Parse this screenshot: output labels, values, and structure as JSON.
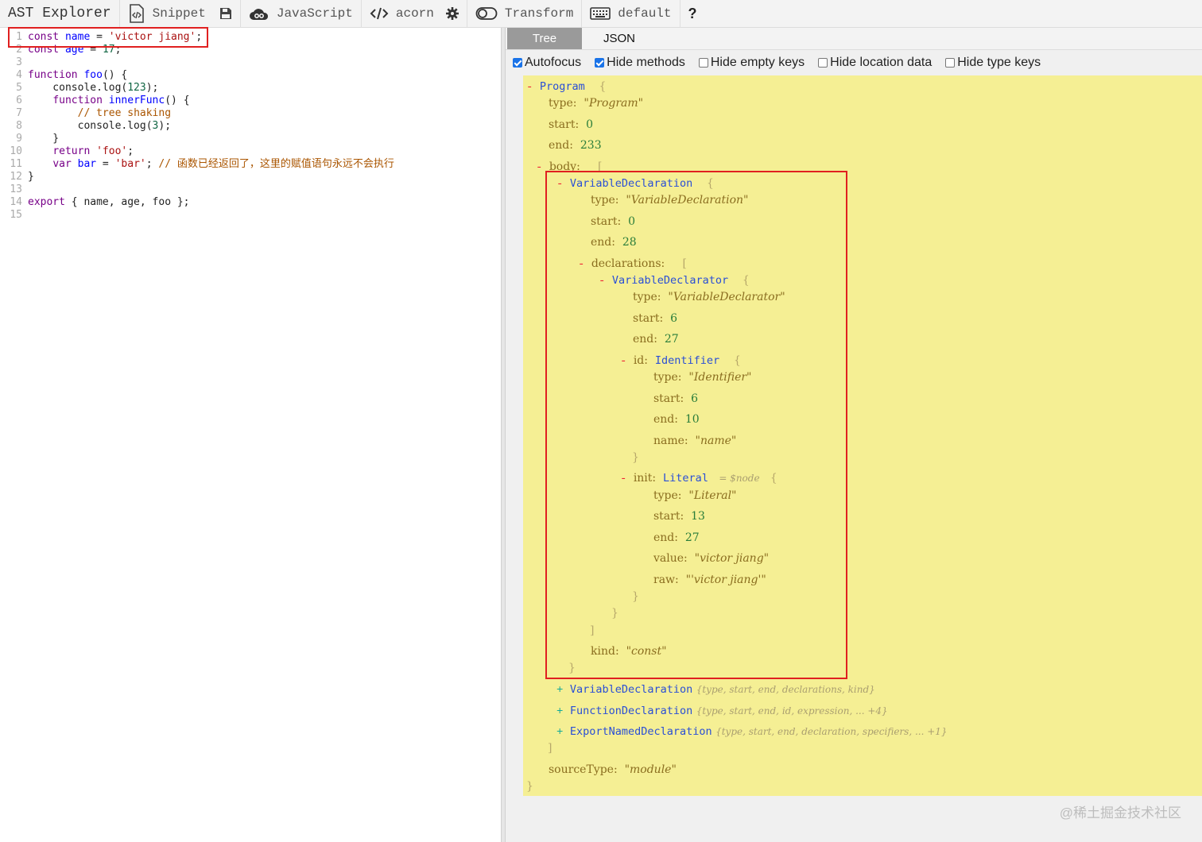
{
  "toolbar": {
    "title": "AST Explorer",
    "snippet": "Snippet",
    "language": "JavaScript",
    "parser": "acorn",
    "transform": "Transform",
    "keymap": "default",
    "help": "?"
  },
  "editor": {
    "lines": [
      {
        "n": "1",
        "segments": [
          {
            "t": "const",
            "c": "kw"
          },
          {
            "t": " "
          },
          {
            "t": "name",
            "c": "def"
          },
          {
            "t": " = "
          },
          {
            "t": "'victor jiang'",
            "c": "str"
          },
          {
            "t": ";"
          }
        ]
      },
      {
        "n": "2",
        "segments": [
          {
            "t": "const",
            "c": "kw"
          },
          {
            "t": " "
          },
          {
            "t": "age",
            "c": "def"
          },
          {
            "t": " = "
          },
          {
            "t": "17",
            "c": "num"
          },
          {
            "t": ";"
          }
        ]
      },
      {
        "n": "3",
        "segments": []
      },
      {
        "n": "4",
        "segments": [
          {
            "t": "function",
            "c": "kw"
          },
          {
            "t": " "
          },
          {
            "t": "foo",
            "c": "def"
          },
          {
            "t": "() {"
          }
        ]
      },
      {
        "n": "5",
        "segments": [
          {
            "t": "    console.log("
          },
          {
            "t": "123",
            "c": "num"
          },
          {
            "t": ");"
          }
        ]
      },
      {
        "n": "6",
        "segments": [
          {
            "t": "    "
          },
          {
            "t": "function",
            "c": "kw"
          },
          {
            "t": " "
          },
          {
            "t": "innerFunc",
            "c": "def"
          },
          {
            "t": "() {"
          }
        ]
      },
      {
        "n": "7",
        "segments": [
          {
            "t": "        "
          },
          {
            "t": "// tree shaking",
            "c": "com"
          }
        ]
      },
      {
        "n": "8",
        "segments": [
          {
            "t": "        console.log("
          },
          {
            "t": "3",
            "c": "num"
          },
          {
            "t": ");"
          }
        ]
      },
      {
        "n": "9",
        "segments": [
          {
            "t": "    }"
          }
        ]
      },
      {
        "n": "10",
        "segments": [
          {
            "t": "    "
          },
          {
            "t": "return",
            "c": "kw"
          },
          {
            "t": " "
          },
          {
            "t": "'foo'",
            "c": "str"
          },
          {
            "t": ";"
          }
        ]
      },
      {
        "n": "11",
        "segments": [
          {
            "t": "    "
          },
          {
            "t": "var",
            "c": "kw"
          },
          {
            "t": " "
          },
          {
            "t": "bar",
            "c": "def"
          },
          {
            "t": " = "
          },
          {
            "t": "'bar'",
            "c": "str"
          },
          {
            "t": "; "
          },
          {
            "t": "// 函数已经返回了，这里的赋值语句永远不会执行",
            "c": "com"
          }
        ]
      },
      {
        "n": "12",
        "segments": [
          {
            "t": "}"
          }
        ]
      },
      {
        "n": "13",
        "segments": []
      },
      {
        "n": "14",
        "segments": [
          {
            "t": "export",
            "c": "kw"
          },
          {
            "t": " { name, age, foo };"
          }
        ]
      },
      {
        "n": "15",
        "segments": []
      }
    ]
  },
  "output": {
    "tabs": [
      "Tree",
      "JSON"
    ],
    "options": [
      {
        "label": "Autofocus",
        "checked": true
      },
      {
        "label": "Hide methods",
        "checked": true
      },
      {
        "label": "Hide empty keys",
        "checked": false
      },
      {
        "label": "Hide location data",
        "checked": false
      },
      {
        "label": "Hide type keys",
        "checked": false
      }
    ],
    "tree": {
      "program": "Program",
      "program_type": "\"Program\"",
      "program_start": "0",
      "program_end": "233",
      "body_key": "body:",
      "vd_name": "VariableDeclaration",
      "vd_type": "\"VariableDeclaration\"",
      "vd_start": "0",
      "vd_end": "28",
      "decls_key": "declarations:",
      "vdr_name": "VariableDeclarator",
      "vdr_type": "\"VariableDeclarator\"",
      "vdr_start": "6",
      "vdr_end": "27",
      "id_key": "id:",
      "id_name": "Identifier",
      "id_type": "\"Identifier\"",
      "id_start": "6",
      "id_end": "10",
      "id_value": "\"name\"",
      "init_key": "init:",
      "init_name": "Literal",
      "init_hint": "= $node",
      "lit_type": "\"Literal\"",
      "lit_start": "13",
      "lit_end": "27",
      "lit_value": "\"victor jiang\"",
      "lit_raw": "\"'victor jiang'\"",
      "kind_value": "\"const\"",
      "collapsed": [
        {
          "name": "VariableDeclaration",
          "summary": "{type, start, end, declarations, kind}"
        },
        {
          "name": "FunctionDeclaration",
          "summary": "{type, start, end, id, expression, ... +4}"
        },
        {
          "name": "ExportNamedDeclaration",
          "summary": "{type, start, end, declaration, specifiers, ... +1}"
        }
      ],
      "source_type_key": "sourceType:",
      "source_type_value": "\"module\""
    }
  },
  "watermark": "@稀土掘金技术社区"
}
